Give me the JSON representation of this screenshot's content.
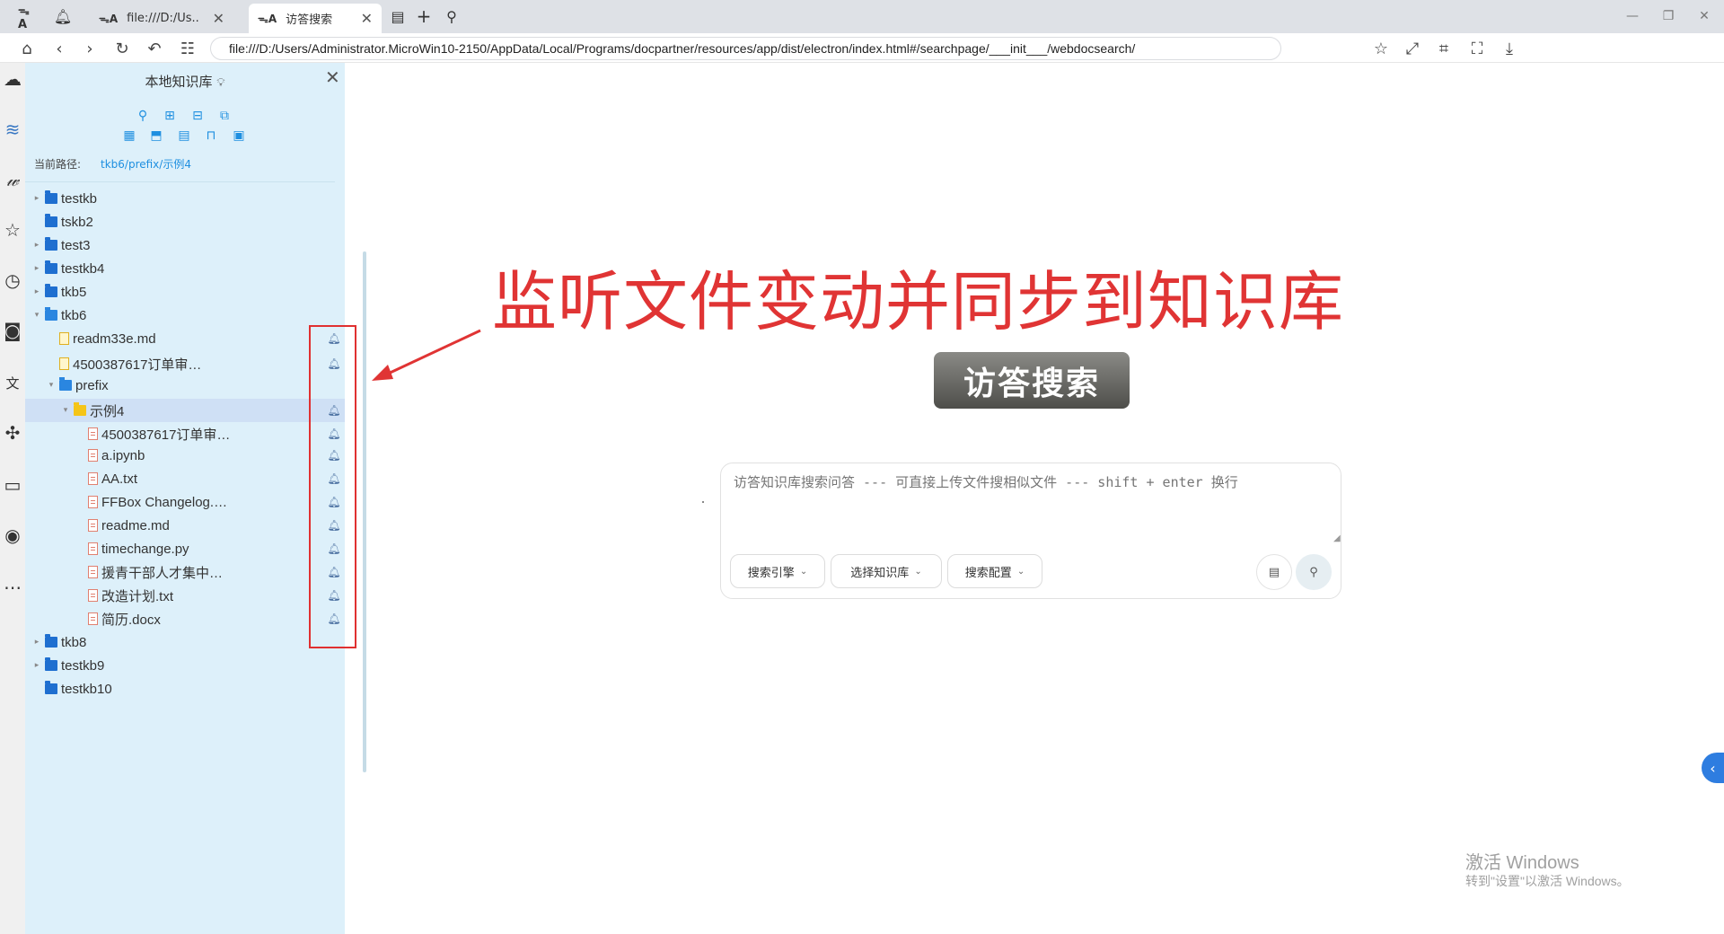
{
  "tabs": [
    {
      "title": "file:///D:/Us..",
      "active": false
    },
    {
      "title": "访答搜索",
      "active": true
    }
  ],
  "address": "file:///D:/Users/Administrator.MicroWin10-2150/AppData/Local/Programs/docpartner/resources/app/dist/electron/index.html#/searchpage/___init___/webdocsearch/",
  "rail_icons": [
    "cloud-icon",
    "layers-icon",
    "handwriting-icon",
    "star-icon",
    "clock-icon",
    "camera-icon",
    "translate-icon",
    "puzzle-icon",
    "window-icon",
    "user-icon",
    "more-icon"
  ],
  "panel": {
    "title": "本地知识库",
    "path_label": "当前路径:",
    "path_value": "tkb6/prefix/示例4",
    "tree": [
      {
        "label": "testkb",
        "kind": "folder",
        "depth": 0,
        "caret": "▸",
        "bell": false
      },
      {
        "label": "tskb2",
        "kind": "folder",
        "depth": 0,
        "caret": "",
        "bell": false
      },
      {
        "label": "test3",
        "kind": "folder",
        "depth": 0,
        "caret": "▸",
        "bell": false
      },
      {
        "label": "testkb4",
        "kind": "folder",
        "depth": 0,
        "caret": "▸",
        "bell": false
      },
      {
        "label": "tkb5",
        "kind": "folder",
        "depth": 0,
        "caret": "▸",
        "bell": false
      },
      {
        "label": "tkb6",
        "kind": "folder-open",
        "depth": 0,
        "caret": "▾",
        "bell": false
      },
      {
        "label": "readm33e.md",
        "kind": "doc-y",
        "depth": 1,
        "caret": "",
        "bell": true
      },
      {
        "label": "4500387617订单审…",
        "kind": "doc-y",
        "depth": 1,
        "caret": "",
        "bell": true
      },
      {
        "label": "prefix",
        "kind": "folder-open",
        "depth": 1,
        "caret": "▾",
        "bell": false
      },
      {
        "label": "示例4",
        "kind": "folder-yellow",
        "depth": 2,
        "caret": "▾",
        "bell": true,
        "selected": true
      },
      {
        "label": "4500387617订单审…",
        "kind": "doc-r",
        "depth": 3,
        "caret": "",
        "bell": true
      },
      {
        "label": "a.ipynb",
        "kind": "doc-r",
        "depth": 3,
        "caret": "",
        "bell": true
      },
      {
        "label": "AA.txt",
        "kind": "doc-r",
        "depth": 3,
        "caret": "",
        "bell": true
      },
      {
        "label": "FFBox Changelog.…",
        "kind": "doc-r",
        "depth": 3,
        "caret": "",
        "bell": true
      },
      {
        "label": "readme.md",
        "kind": "doc-r",
        "depth": 3,
        "caret": "",
        "bell": true
      },
      {
        "label": "timechange.py",
        "kind": "doc-r",
        "depth": 3,
        "caret": "",
        "bell": true
      },
      {
        "label": "援青干部人才集中…",
        "kind": "doc-r",
        "depth": 3,
        "caret": "",
        "bell": true
      },
      {
        "label": "改造计划.txt",
        "kind": "doc-r",
        "depth": 3,
        "caret": "",
        "bell": true
      },
      {
        "label": "简历.docx",
        "kind": "doc-r",
        "depth": 3,
        "caret": "",
        "bell": true
      },
      {
        "label": "tkb8",
        "kind": "folder",
        "depth": 0,
        "caret": "▸",
        "bell": false
      },
      {
        "label": "testkb9",
        "kind": "folder",
        "depth": 0,
        "caret": "▸",
        "bell": false
      },
      {
        "label": "testkb10",
        "kind": "folder",
        "depth": 0,
        "caret": "",
        "bell": false
      }
    ]
  },
  "annotation": "监听文件变动并同步到知识库",
  "logo": {
    "text": "访答搜索"
  },
  "search": {
    "placeholder": "访答知识库搜索问答 --- 可直接上传文件搜相似文件 --- shift + enter 换行",
    "engine_label": "搜索引擎",
    "kb_label": "选择知识库",
    "config_label": "搜索配置"
  },
  "watermark": {
    "line1": "激活 Windows",
    "line2": "转到\"设置\"以激活 Windows。"
  },
  "colors": {
    "annotation": "#e03434",
    "accent": "#1e8fe0",
    "panel_bg": "#ddf0fa"
  }
}
